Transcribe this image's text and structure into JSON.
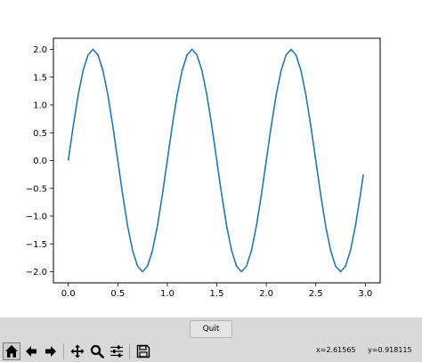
{
  "chart_data": {
    "type": "line",
    "title": "",
    "xlabel": "",
    "ylabel": "",
    "xlim": [
      -0.15,
      3.15
    ],
    "ylim": [
      -2.2,
      2.2
    ],
    "xticks": [
      0.0,
      0.5,
      1.0,
      1.5,
      2.0,
      2.5,
      3.0
    ],
    "xtick_labels": [
      "0.0",
      "0.5",
      "1.0",
      "1.5",
      "2.0",
      "2.5",
      "3.0"
    ],
    "yticks": [
      2.0,
      1.5,
      1.0,
      0.5,
      0.0,
      -0.5,
      -1.0,
      -1.5,
      -2.0
    ],
    "ytick_labels": [
      "2.0",
      "1.5",
      "1.0",
      "0.5",
      "0.0",
      "−0.5",
      "−1.0",
      "−1.5",
      "−2.0"
    ],
    "grid": false,
    "legend": "none",
    "series": [
      {
        "color": "#1f77b4",
        "function": "y = 2·sin(2πx)",
        "x": [
          0.0,
          0.05,
          0.1,
          0.15,
          0.2,
          0.25,
          0.3,
          0.35,
          0.4,
          0.45,
          0.5,
          0.55,
          0.6,
          0.65,
          0.7,
          0.75,
          0.8,
          0.85,
          0.9,
          0.95,
          1.0,
          1.05,
          1.1,
          1.15,
          1.2,
          1.25,
          1.3,
          1.35,
          1.4,
          1.45,
          1.5,
          1.55,
          1.6,
          1.65,
          1.7,
          1.75,
          1.8,
          1.85,
          1.9,
          1.95,
          2.0,
          2.05,
          2.1,
          2.15,
          2.2,
          2.25,
          2.3,
          2.35,
          2.4,
          2.45,
          2.5,
          2.55,
          2.6,
          2.65,
          2.7,
          2.75,
          2.8,
          2.85,
          2.9,
          2.95,
          2.98
        ],
        "y": [
          0.0,
          0.62,
          1.18,
          1.62,
          1.9,
          2.0,
          1.9,
          1.62,
          1.18,
          0.62,
          0.0,
          -0.62,
          -1.18,
          -1.62,
          -1.9,
          -2.0,
          -1.9,
          -1.62,
          -1.18,
          -0.62,
          0.0,
          0.62,
          1.18,
          1.62,
          1.9,
          2.0,
          1.9,
          1.62,
          1.18,
          0.62,
          0.0,
          -0.62,
          -1.18,
          -1.62,
          -1.9,
          -2.0,
          -1.9,
          -1.62,
          -1.18,
          -0.62,
          0.0,
          0.62,
          1.18,
          1.62,
          1.9,
          2.0,
          1.9,
          1.62,
          1.18,
          0.62,
          0.0,
          -0.62,
          -1.18,
          -1.62,
          -1.9,
          -2.0,
          -1.9,
          -1.62,
          -1.18,
          -0.62,
          -0.25
        ]
      }
    ]
  },
  "quit_label": "Quit",
  "toolbar": {
    "buttons": [
      {
        "name": "home-button",
        "icon": "home-icon",
        "active": true
      },
      {
        "name": "back-button",
        "icon": "arrow-left-icon",
        "active": false
      },
      {
        "name": "forward-button",
        "icon": "arrow-right-icon",
        "active": false
      },
      {
        "name": "pan-button",
        "icon": "move-icon",
        "active": false
      },
      {
        "name": "zoom-button",
        "icon": "magnifier-icon",
        "active": false
      },
      {
        "name": "subplots-button",
        "icon": "sliders-icon",
        "active": false
      },
      {
        "name": "save-button",
        "icon": "floppy-disk-icon",
        "active": false
      }
    ]
  },
  "status": {
    "x_readout": "x=2.61565",
    "y_readout": "y=0.918115"
  }
}
